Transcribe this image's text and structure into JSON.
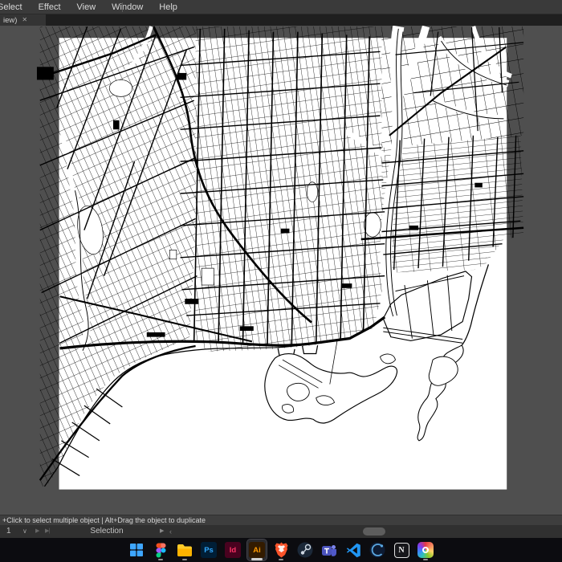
{
  "app_name": "Adobe Illustrator",
  "menu_bar": {
    "items": [
      {
        "label": "Select"
      },
      {
        "label": "Effect"
      },
      {
        "label": "View"
      },
      {
        "label": "Window"
      },
      {
        "label": "Help"
      }
    ],
    "note": "left edge of window cropped; first item partially visible as 'elect'"
  },
  "tab_bar": {
    "active_tab": {
      "label": "iew)",
      "close_glyph": "✕"
    }
  },
  "canvas": {
    "artwork": "toronto-street-map",
    "artboard_color": "#ffffff",
    "ink_color": "#000000",
    "pasteboard_color": "#4f4f4f"
  },
  "hint_bar": {
    "text": "+Click to select multiple object   |   Alt+Drag the object to duplicate"
  },
  "status_bar": {
    "artboard_number": "1",
    "dropdown_glyph": "∨",
    "nav_next_glyph": "▶",
    "nav_last_glyph": "▶|",
    "status_label": "Selection",
    "flyout_glyph": "▶",
    "scroll_left_glyph": "‹"
  },
  "taskbar": {
    "items": [
      {
        "name": "start"
      },
      {
        "name": "figma",
        "indicator": true
      },
      {
        "name": "file-explorer",
        "indicator": true
      },
      {
        "name": "photoshop",
        "label": "Ps",
        "fg": "#31a8ff",
        "bg": "#001e36"
      },
      {
        "name": "indesign",
        "label": "Id",
        "fg": "#ff3366",
        "bg": "#49021f"
      },
      {
        "name": "illustrator",
        "label": "Ai",
        "fg": "#ff9a00",
        "bg": "#331b00",
        "active": true,
        "indicator": true
      },
      {
        "name": "brave",
        "indicator": true
      },
      {
        "name": "steam"
      },
      {
        "name": "teams"
      },
      {
        "name": "vscode"
      },
      {
        "name": "cinema4d"
      },
      {
        "name": "notion",
        "label": "N"
      },
      {
        "name": "photos",
        "indicator": true
      }
    ]
  }
}
